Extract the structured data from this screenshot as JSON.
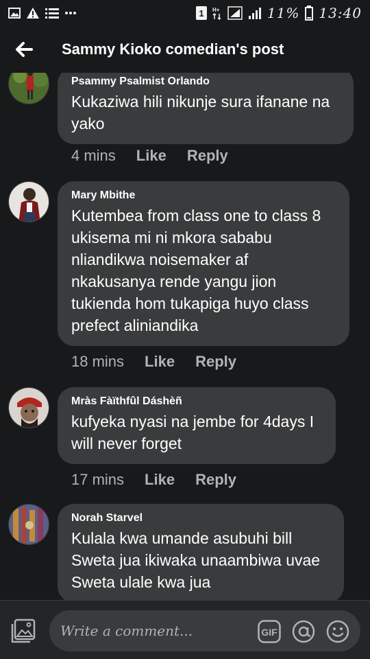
{
  "status_bar": {
    "time": "13:40",
    "battery": "11%",
    "sim": "1"
  },
  "header": {
    "title": "Sammy Kioko comedian's post"
  },
  "comments": [
    {
      "author": "Psammy Psalmist Orlando",
      "text": "Kukaziwa hili nikunje sura ifanane na yako",
      "time": "4 mins",
      "like": "Like",
      "reply": "Reply"
    },
    {
      "author": "Mary Mbithe",
      "text": "Kutembea from class one to class 8 ukisema mi ni mkora sababu nliandikwa noisemaker af nkakusanya rende yangu jion tukienda hom tukapiga huyo class prefect aliniandika",
      "time": "18 mins",
      "like": "Like",
      "reply": "Reply"
    },
    {
      "author": "Mràs Fàïthfûl Dáshèñ",
      "text": "kufyeka nyasi na jembe for 4days I will never forget",
      "time": "17 mins",
      "like": "Like",
      "reply": "Reply"
    },
    {
      "author": "Norah Starvel",
      "text": "Kulala kwa umande asubuhi bill Sweta jua ikiwaka unaambiwa uvae Sweta ulale kwa jua",
      "time": "",
      "like": "",
      "reply": ""
    }
  ],
  "composer": {
    "placeholder": "Write a comment...",
    "gif_label": "GIF"
  },
  "colors": {
    "background": "#18191a",
    "bubble": "#3a3b3c",
    "meta_text": "#b0b3b8"
  }
}
